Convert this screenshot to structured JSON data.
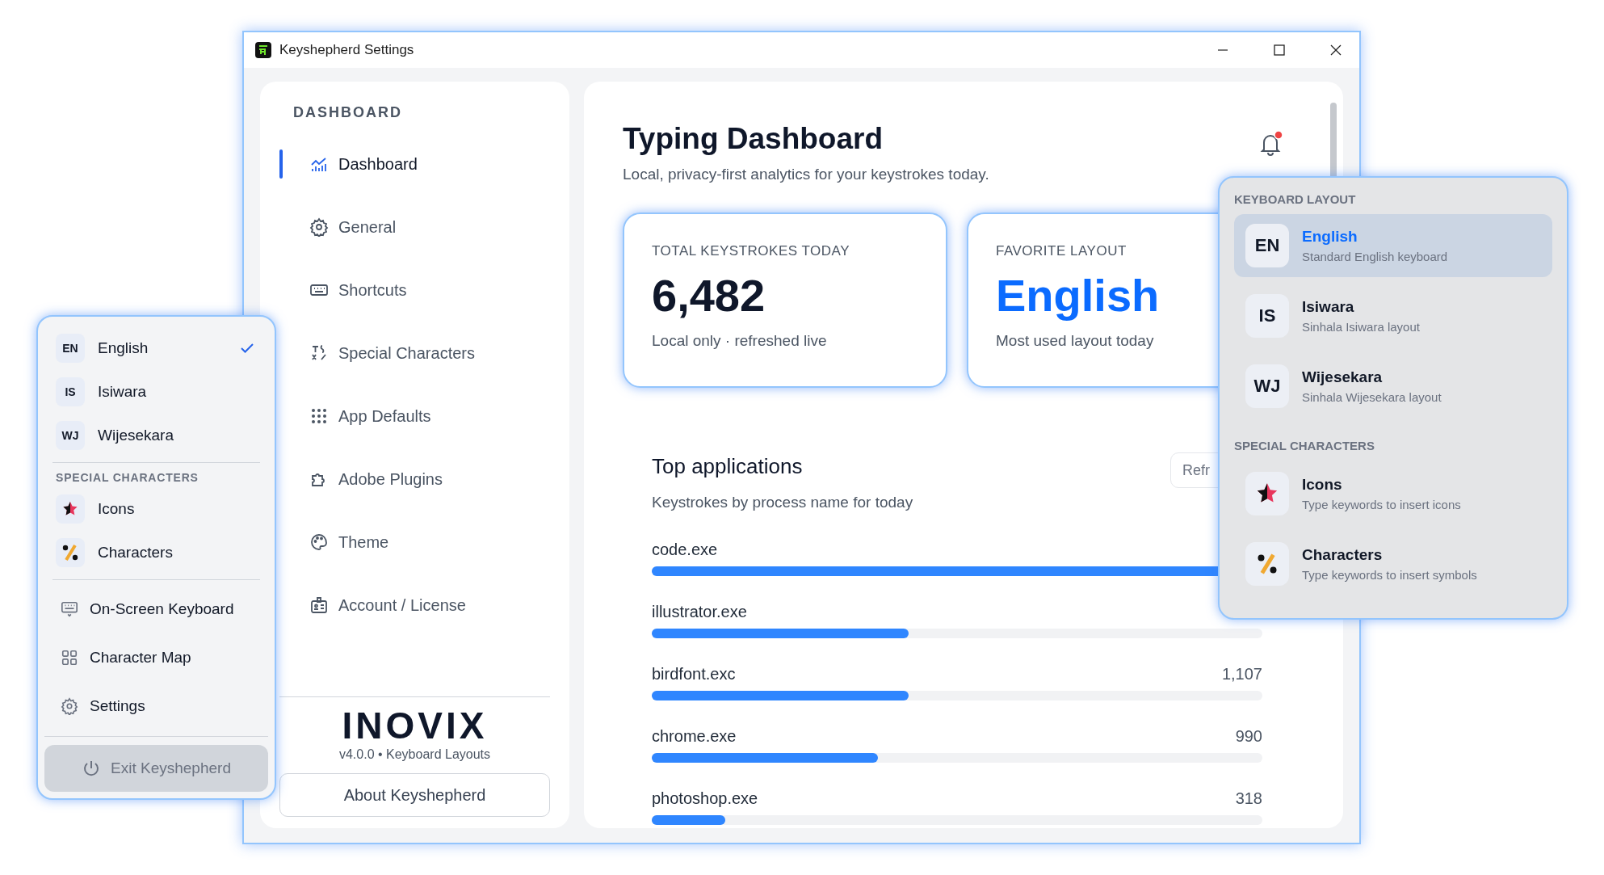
{
  "window": {
    "title": "Keyshepherd Settings"
  },
  "sidebar": {
    "heading": "DASHBOARD",
    "items": [
      {
        "label": "Dashboard",
        "kind": "chart",
        "selected": true
      },
      {
        "label": "General",
        "kind": "gear",
        "selected": false
      },
      {
        "label": "Shortcuts",
        "kind": "keyboard",
        "selected": false
      },
      {
        "label": "Special Characters",
        "kind": "symbols",
        "selected": false
      },
      {
        "label": "App Defaults",
        "kind": "dots",
        "selected": false
      },
      {
        "label": "Adobe Plugins",
        "kind": "puzzle",
        "selected": false
      },
      {
        "label": "Theme",
        "kind": "palette",
        "selected": false
      },
      {
        "label": "Account / License",
        "kind": "badge",
        "selected": false
      }
    ],
    "logo": "INOVIX",
    "version": "v4.0.0 • Keyboard Layouts",
    "about_button": "About Keyshepherd"
  },
  "dashboard": {
    "title": "Typing Dashboard",
    "subtitle": "Local, privacy-first analytics for your keystrokes today.",
    "notification_unread": true,
    "cards": [
      {
        "label": "TOTAL KEYSTROKES TODAY",
        "value": "6,482",
        "note": "Local only · refreshed live",
        "kind": "count"
      },
      {
        "label": "FAVORITE LAYOUT",
        "value": "English",
        "note": "Most used layout today",
        "kind": "accent"
      }
    ],
    "top_apps": {
      "title": "Top applications",
      "subtitle": "Keystrokes by process name for today",
      "refresh_button": "Refr",
      "rows": [
        {
          "name": "code.exe",
          "level": 1.0
        },
        {
          "name": "illustrator.exe",
          "level": 0.42
        },
        {
          "name": "birdfont.exc",
          "value": "1,107",
          "level": 0.42
        },
        {
          "name": "chrome.exe",
          "value": "990",
          "level": 0.37
        },
        {
          "name": "photoshop.exe",
          "value": "318",
          "level": 0.12
        }
      ]
    }
  },
  "tray_menu": {
    "layouts": [
      {
        "badge": "EN",
        "label": "English",
        "selected": true
      },
      {
        "badge": "IS",
        "label": "Isiwara",
        "selected": false
      },
      {
        "badge": "WJ",
        "label": "Wijesekara",
        "selected": false
      }
    ],
    "special_heading": "SPECIAL CHARACTERS",
    "special": [
      {
        "kind": "star",
        "label": "Icons"
      },
      {
        "kind": "percent",
        "label": "Characters"
      }
    ],
    "tools": [
      {
        "kind": "keyboard",
        "label": "On-Screen Keyboard"
      },
      {
        "kind": "grid",
        "label": "Character Map"
      },
      {
        "kind": "gear",
        "label": "Settings"
      }
    ],
    "exit_button": "Exit Keyshepherd"
  },
  "layout_popup": {
    "heading": "KEYBOARD LAYOUT",
    "layouts": [
      {
        "badge": "EN",
        "label": "English",
        "description": "Standard English keyboard",
        "selected": true
      },
      {
        "badge": "IS",
        "label": "Isiwara",
        "description": "Sinhala Isiwara layout",
        "selected": false
      },
      {
        "badge": "WJ",
        "label": "Wijesekara",
        "description": "Sinhala Wijesekara layout",
        "selected": false
      }
    ],
    "special_heading": "SPECIAL CHARACTERS",
    "special": [
      {
        "kind": "star",
        "label": "Icons",
        "description": "Type keywords to insert icons"
      },
      {
        "kind": "percent",
        "label": "Characters",
        "description": "Type keywords to insert symbols"
      }
    ]
  }
}
